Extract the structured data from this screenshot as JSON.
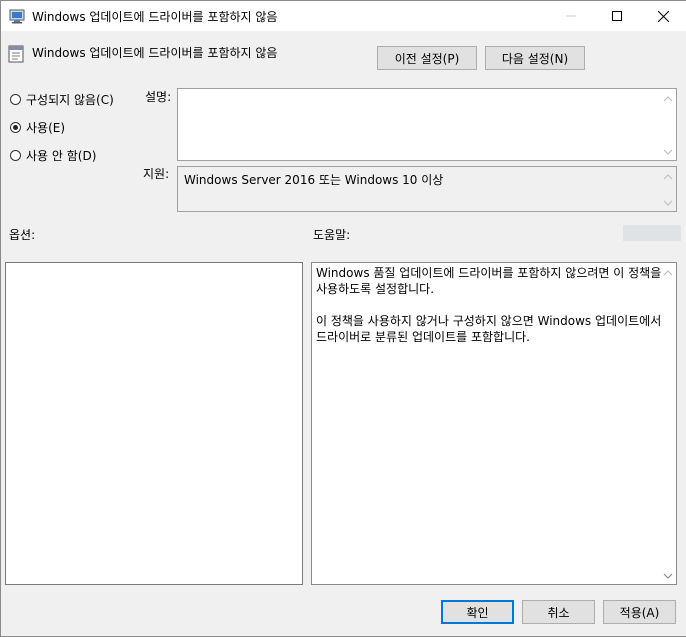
{
  "window": {
    "title": "Windows 업데이트에 드라이버를 포함하지 않음"
  },
  "header": {
    "title": "Windows 업데이트에 드라이버를 포함하지 않음",
    "prev_button": "이전 설정(P)",
    "next_button": "다음 설정(N)"
  },
  "state": {
    "options": [
      {
        "label": "구성되지 않음(C)",
        "selected": false
      },
      {
        "label": "사용(E)",
        "selected": true
      },
      {
        "label": "사용 안 함(D)",
        "selected": false
      }
    ]
  },
  "comment": {
    "label": "설명:",
    "value": ""
  },
  "supported": {
    "label": "지원:",
    "value": "Windows Server 2016 또는 Windows 10 이상"
  },
  "options_section": {
    "label": "옵션:"
  },
  "help_section": {
    "label": "도움말:",
    "paragraphs": [
      "Windows 품질 업데이트에 드라이버를 포함하지 않으려면 이 정책을 사용하도록 설정합니다.",
      "이 정책을 사용하지 않거나 구성하지 않으면 Windows 업데이트에서 드라이버로 분류된 업데이트를 포함합니다."
    ]
  },
  "footer": {
    "ok": "확인",
    "cancel": "취소",
    "apply": "적용(A)"
  }
}
